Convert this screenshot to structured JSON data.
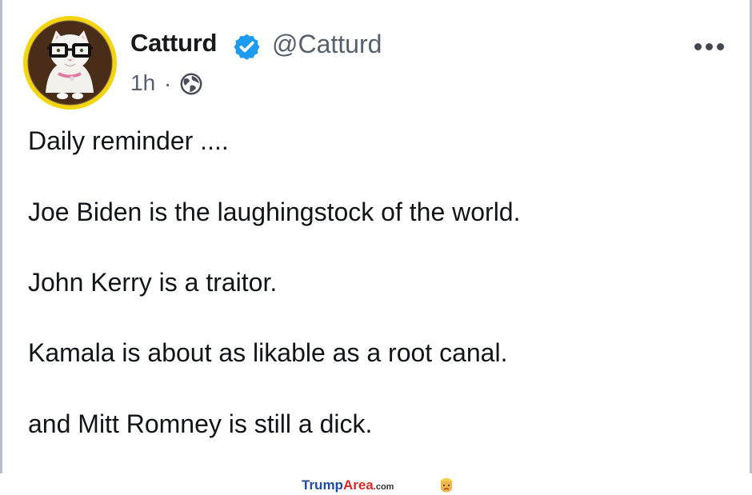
{
  "post": {
    "author": {
      "display_name": "Catturd",
      "handle": "@Catturd",
      "verified": true,
      "avatar_icon": "cat-with-glasses-avatar"
    },
    "timestamp": "1h",
    "separator": "·",
    "visibility_icon": "globe-icon",
    "more_icon": "more-dots-icon",
    "content_lines": [
      "Daily reminder ....",
      "Joe Biden is the laughingstock of the world.",
      "John Kerry is a traitor.",
      "Kamala is about as likable as a root canal.",
      "and Mitt Romney is still a dick."
    ]
  },
  "watermark": {
    "brand": "Trump",
    "brand_accent": "Area",
    "domain_suffix": ".com",
    "icon": "trump-face-icon"
  },
  "colors": {
    "verified_blue": "#1d9bf0",
    "text_primary": "#0f1419",
    "text_secondary": "#57616d",
    "avatar_ring": "#f2d40f",
    "watermark_blue": "#214d9f",
    "watermark_red": "#d62a2a"
  }
}
